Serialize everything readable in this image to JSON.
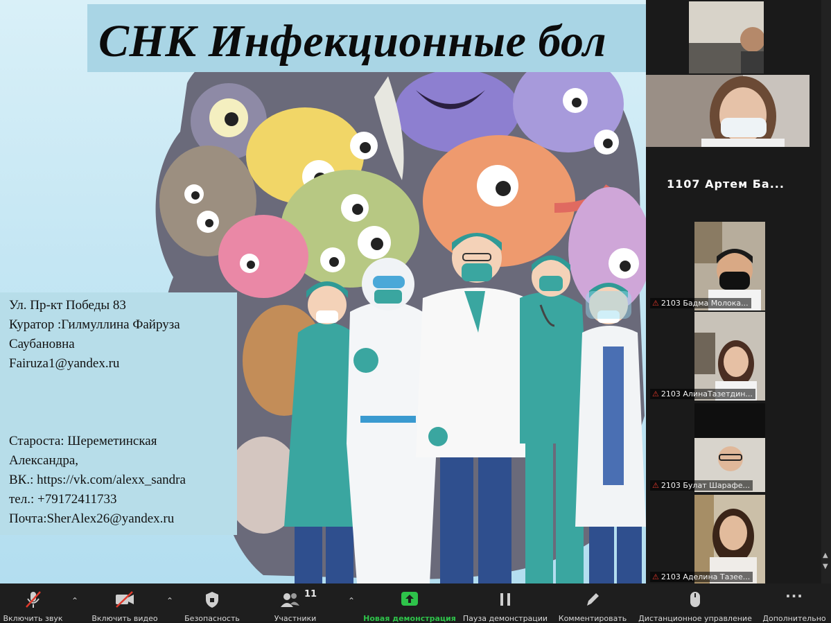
{
  "slide": {
    "title": "СНК Инфекционные бол",
    "info_lines": [
      "Ул. Пр-кт Победы 83",
      "Куратор :Гилмуллина Файруза",
      "Саубановна",
      "Fairuza1@yandex.ru",
      "Староста: Шереметинская",
      "Александра,",
      "ВК.: https://vk.com/alexx_sandra",
      "тел.: +79172411733",
      "Почта:SherAlex26@yandex.ru"
    ]
  },
  "participants": {
    "name_only": "1107 Артем Ба...",
    "tiles": [
      {
        "name": "2103 Бадма Молока..."
      },
      {
        "name": "2103 АлинаТазетдин..."
      },
      {
        "name": "2103 Булат Шарафе..."
      },
      {
        "name": "2103 Аделина Тазее..."
      }
    ]
  },
  "toolbar": {
    "unmute": "Включить звук",
    "start_video": "Включить видео",
    "security": "Безопасность",
    "participants": "Участники",
    "participants_count": "11",
    "new_share": "Новая демонстрация",
    "pause_share": "Пауза демонстрации",
    "annotate": "Комментировать",
    "remote_control": "Дистанционное управление",
    "more": "Дополнительно",
    "more_icon": "···"
  },
  "colors": {
    "accent_green": "#2ec34a",
    "muted_red": "#e0392b",
    "slide_bg": "#c4e6f3",
    "title_box": "#a9d5e5",
    "info_box": "#b7dde9"
  }
}
